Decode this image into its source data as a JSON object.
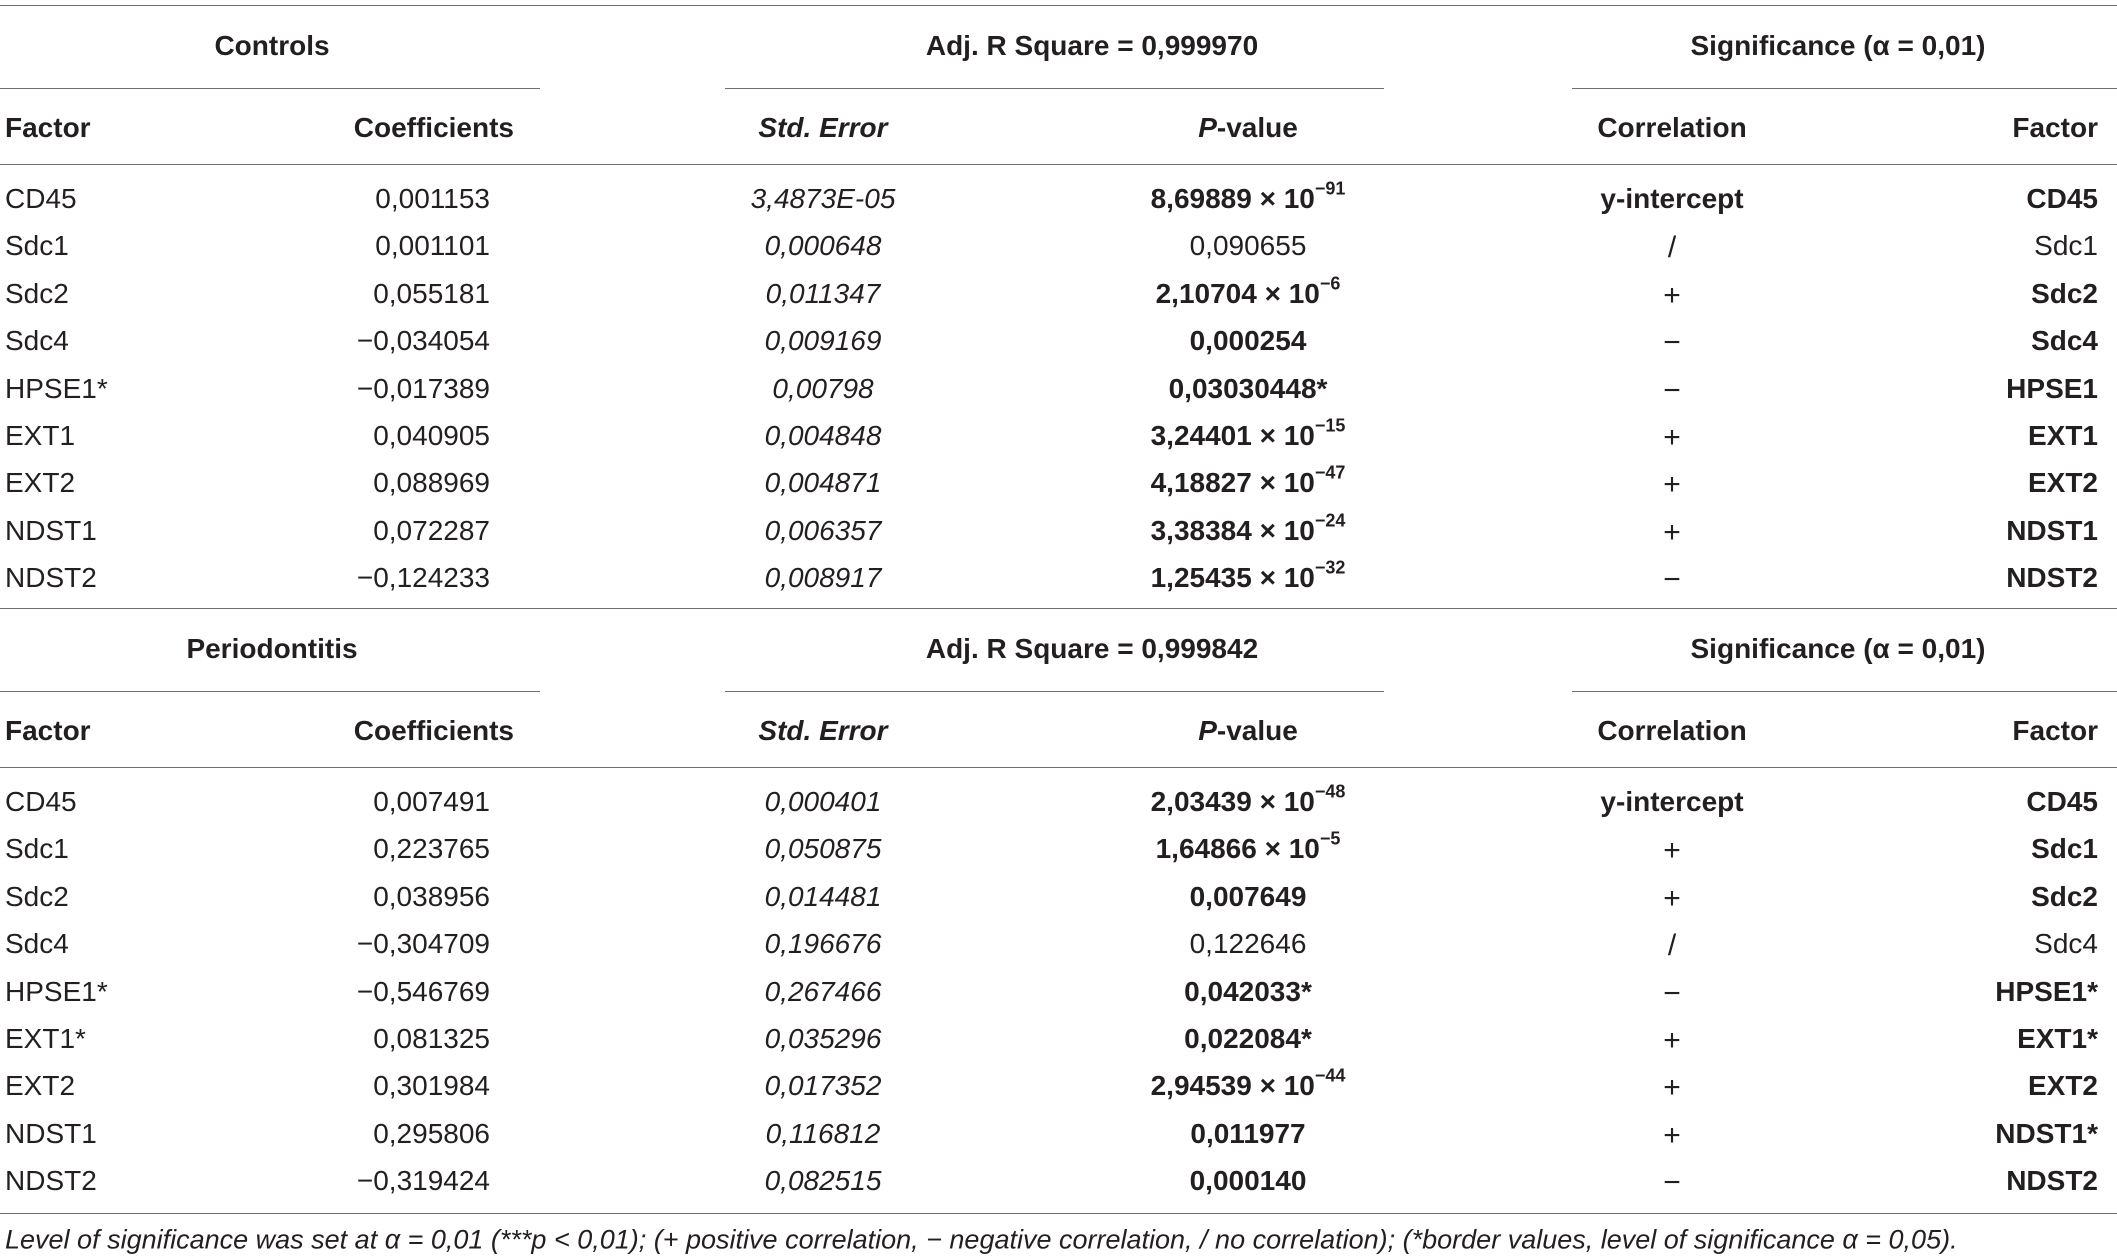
{
  "footnote": "Level of significance was set at α = 0,01 (***p < 0,01); (+ positive correlation, − negative correlation, / no correlation); (*border values, level of significance α = 0,05).",
  "sections": [
    {
      "group_label": "Controls",
      "fit_label": "Adj. R Square = 0,999970",
      "signif_label": "Significance (α = 0,01)",
      "headers": {
        "factor": "Factor",
        "coefficients": "Coefficients",
        "std_error": "Std. Error",
        "p_value_italic": "P",
        "p_value_rest": "-value",
        "correlation": "Correlation",
        "factor2": "Factor"
      },
      "rows": [
        {
          "factor": "CD45",
          "coef": "0,001153",
          "se": "3,4873E-05",
          "p": "8,69889 × 10",
          "p_exp": "−91",
          "p_bold": true,
          "corr": "y-intercept",
          "factor2": "CD45",
          "sig": true
        },
        {
          "factor": "Sdc1",
          "coef": "0,001101",
          "se": "0,000648",
          "p": "0,090655",
          "p_exp": "",
          "p_bold": false,
          "corr": "/",
          "factor2": "Sdc1",
          "sig": false
        },
        {
          "factor": "Sdc2",
          "coef": "0,055181",
          "se": "0,011347",
          "p": "2,10704 × 10",
          "p_exp": "−6",
          "p_bold": true,
          "corr": "+",
          "factor2": "Sdc2",
          "sig": true
        },
        {
          "factor": "Sdc4",
          "coef": "−0,034054",
          "se": "0,009169",
          "p": "0,000254",
          "p_exp": "",
          "p_bold": true,
          "corr": "−",
          "factor2": "Sdc4",
          "sig": true
        },
        {
          "factor": "HPSE1*",
          "coef": "−0,017389",
          "se": "0,00798",
          "p": "0,03030448*",
          "p_exp": "",
          "p_bold": true,
          "corr": "−",
          "factor2": "HPSE1",
          "sig": true
        },
        {
          "factor": "EXT1",
          "coef": "0,040905",
          "se": "0,004848",
          "p": "3,24401 × 10",
          "p_exp": "−15",
          "p_bold": true,
          "corr": "+",
          "factor2": "EXT1",
          "sig": true
        },
        {
          "factor": "EXT2",
          "coef": "0,088969",
          "se": "0,004871",
          "p": "4,18827 × 10",
          "p_exp": "−47",
          "p_bold": true,
          "corr": "+",
          "factor2": "EXT2",
          "sig": true
        },
        {
          "factor": "NDST1",
          "coef": "0,072287",
          "se": "0,006357",
          "p": "3,38384 × 10",
          "p_exp": "−24",
          "p_bold": true,
          "corr": "+",
          "factor2": "NDST1",
          "sig": true
        },
        {
          "factor": "NDST2",
          "coef": "−0,124233",
          "se": "0,008917",
          "p": "1,25435 × 10",
          "p_exp": "−32",
          "p_bold": true,
          "corr": "−",
          "factor2": "NDST2",
          "sig": true
        }
      ]
    },
    {
      "group_label": "Periodontitis",
      "fit_label": "Adj. R Square = 0,999842",
      "signif_label": "Significance (α = 0,01)",
      "headers": {
        "factor": "Factor",
        "coefficients": "Coefficients",
        "std_error": "Std. Error",
        "p_value_italic": "P",
        "p_value_rest": "-value",
        "correlation": "Correlation",
        "factor2": "Factor"
      },
      "rows": [
        {
          "factor": "CD45",
          "coef": "0,007491",
          "se": "0,000401",
          "p": "2,03439 × 10",
          "p_exp": "−48",
          "p_bold": true,
          "corr": "y-intercept",
          "factor2": "CD45",
          "sig": true
        },
        {
          "factor": "Sdc1",
          "coef": "0,223765",
          "se": "0,050875",
          "p": "1,64866 × 10",
          "p_exp": "−5",
          "p_bold": true,
          "corr": "+",
          "factor2": "Sdc1",
          "sig": true
        },
        {
          "factor": "Sdc2",
          "coef": "0,038956",
          "se": "0,014481",
          "p": "0,007649",
          "p_exp": "",
          "p_bold": true,
          "corr": "+",
          "factor2": "Sdc2",
          "sig": true
        },
        {
          "factor": "Sdc4",
          "coef": "−0,304709",
          "se": "0,196676",
          "p": "0,122646",
          "p_exp": "",
          "p_bold": false,
          "corr": "/",
          "factor2": "Sdc4",
          "sig": false
        },
        {
          "factor": "HPSE1*",
          "coef": "−0,546769",
          "se": "0,267466",
          "p": "0,042033*",
          "p_exp": "",
          "p_bold": true,
          "corr": "−",
          "factor2": "HPSE1*",
          "sig": true
        },
        {
          "factor": "EXT1*",
          "coef": "0,081325",
          "se": "0,035296",
          "p": "0,022084*",
          "p_exp": "",
          "p_bold": true,
          "corr": "+",
          "factor2": "EXT1*",
          "sig": true
        },
        {
          "factor": "EXT2",
          "coef": "0,301984",
          "se": "0,017352",
          "p": "2,94539 × 10",
          "p_exp": "−44",
          "p_bold": true,
          "corr": "+",
          "factor2": "EXT2",
          "sig": true
        },
        {
          "factor": "NDST1",
          "coef": "0,295806",
          "se": "0,116812",
          "p": "0,011977",
          "p_exp": "",
          "p_bold": true,
          "corr": "+",
          "factor2": "NDST1*",
          "sig": true
        },
        {
          "factor": "NDST2",
          "coef": "−0,319424",
          "se": "0,082515",
          "p": "0,000140",
          "p_exp": "",
          "p_bold": true,
          "corr": "−",
          "factor2": "NDST2",
          "sig": true
        }
      ]
    }
  ]
}
